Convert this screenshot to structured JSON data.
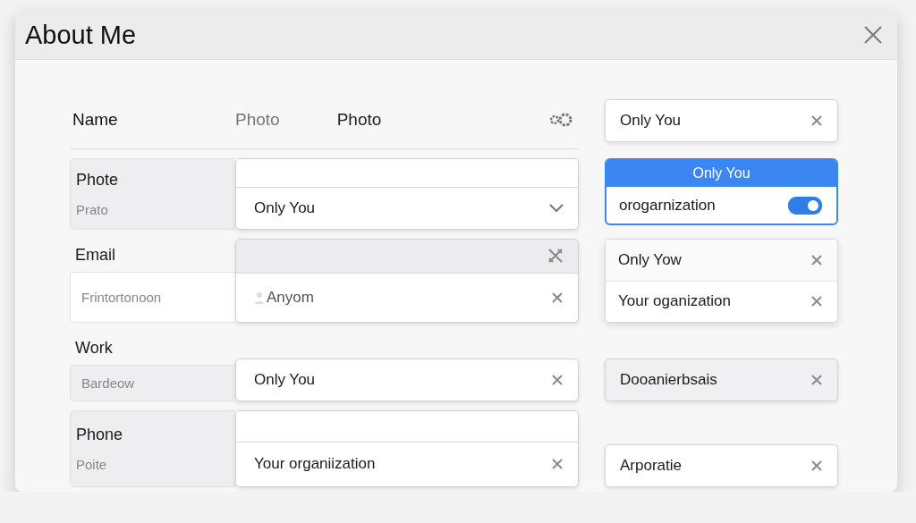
{
  "window": {
    "title": "About Me"
  },
  "header": {
    "label": "Name",
    "columns": [
      {
        "text": "Photo",
        "muted": true
      },
      {
        "text": "Photo",
        "muted": false
      }
    ],
    "right": {
      "kind": "select",
      "value": "Only You",
      "muted": false
    }
  },
  "rows": [
    {
      "left": {
        "kind": "panel",
        "label": "Phote",
        "hint": "Prato"
      },
      "field": {
        "top_bar": true,
        "value": "Only You",
        "dropdown": true,
        "person": false
      },
      "right": {
        "kind": "popover",
        "header": "Only You",
        "option": "orogarnization",
        "on": true
      }
    },
    {
      "left": {
        "kind": "stacked",
        "label": "Email",
        "hint": "Frintortonoon",
        "hint_box": true
      },
      "field": {
        "top_bar": true,
        "tools": true,
        "value": "Anyom",
        "dropdown": false,
        "person": true
      },
      "right": {
        "kind": "list",
        "items": [
          "Only Yow",
          "Your oganization"
        ]
      }
    },
    {
      "left": {
        "kind": "stacked",
        "label": "Work",
        "hint": "Bardeow",
        "hint_box": false
      },
      "field": {
        "top_bar": false,
        "value": "Only You",
        "dropdown": false,
        "person": false
      },
      "right": {
        "kind": "select",
        "value": "Dooanierbsais",
        "muted": true
      }
    },
    {
      "left": {
        "kind": "panel",
        "label": "Phone",
        "hint": "Poite"
      },
      "field": {
        "top_bar": true,
        "value": "Your organiization",
        "dropdown": false,
        "person": false
      },
      "right": {
        "kind": "select",
        "value": "Arporatie",
        "muted": false
      }
    }
  ]
}
